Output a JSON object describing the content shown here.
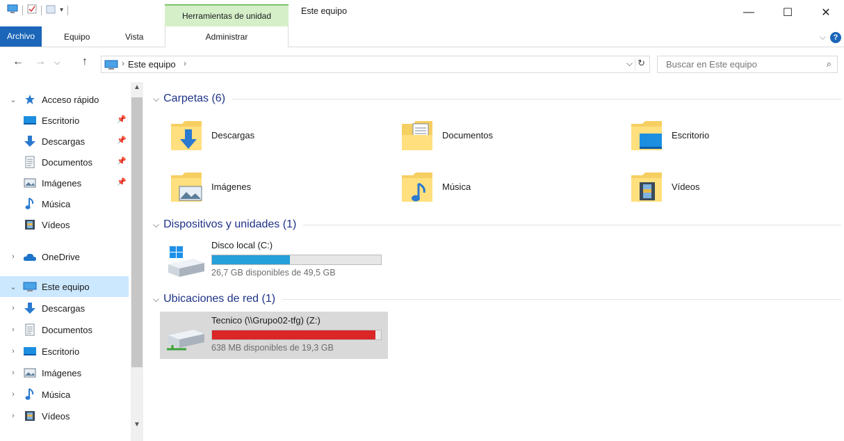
{
  "window": {
    "title": "Este equipo",
    "context_group": "Herramientas de unidad",
    "minimize": "—",
    "maximize": "☐",
    "close": "✕"
  },
  "ribbon": {
    "tabs": [
      "Archivo",
      "Equipo",
      "Vista"
    ],
    "context_tab": "Administrar",
    "collapse_glyph": "⌵",
    "help_glyph": "?"
  },
  "address": {
    "crumb": "Este equipo",
    "separator": "›",
    "back": "←",
    "forward": "→",
    "recent": "⌵",
    "up": "↑",
    "dropdown": "⌵",
    "refresh": "↻"
  },
  "search": {
    "placeholder": "Buscar en Este equipo",
    "icon": "⌕"
  },
  "nav": {
    "items": [
      {
        "label": "Acceso rápido",
        "icon": "star-icon",
        "expanded": "⌄",
        "pinned": ""
      },
      {
        "label": "Escritorio",
        "icon": "desktop-icon",
        "expanded": "",
        "pinned": "📌"
      },
      {
        "label": "Descargas",
        "icon": "download-icon",
        "expanded": "",
        "pinned": "📌"
      },
      {
        "label": "Documentos",
        "icon": "document-icon",
        "expanded": "",
        "pinned": "📌"
      },
      {
        "label": "Imágenes",
        "icon": "pictures-icon",
        "expanded": "",
        "pinned": "📌"
      },
      {
        "label": "Música",
        "icon": "music-icon",
        "expanded": "",
        "pinned": ""
      },
      {
        "label": "Vídeos",
        "icon": "video-icon",
        "expanded": "",
        "pinned": ""
      },
      {
        "label": "OneDrive",
        "icon": "cloud-icon",
        "expanded": "›",
        "pinned": ""
      },
      {
        "label": "Este equipo",
        "icon": "computer-icon",
        "expanded": "⌄",
        "pinned": ""
      },
      {
        "label": "Descargas",
        "icon": "download-icon",
        "expanded": "›",
        "pinned": ""
      },
      {
        "label": "Documentos",
        "icon": "document-icon",
        "expanded": "›",
        "pinned": ""
      },
      {
        "label": "Escritorio",
        "icon": "desktop-icon",
        "expanded": "›",
        "pinned": ""
      },
      {
        "label": "Imágenes",
        "icon": "pictures-icon",
        "expanded": "›",
        "pinned": ""
      },
      {
        "label": "Música",
        "icon": "music-icon",
        "expanded": "›",
        "pinned": ""
      },
      {
        "label": "Vídeos",
        "icon": "video-icon",
        "expanded": "›",
        "pinned": ""
      }
    ]
  },
  "groups": {
    "folders_title": "Carpetas (6)",
    "devices_title": "Dispositivos y unidades (1)",
    "network_title": "Ubicaciones de red (1)",
    "collapse_glyph": "⌵"
  },
  "folders": [
    {
      "name": "Descargas",
      "icon": "downloads-folder-icon"
    },
    {
      "name": "Documentos",
      "icon": "documents-folder-icon"
    },
    {
      "name": "Escritorio",
      "icon": "desktop-folder-icon"
    },
    {
      "name": "Imágenes",
      "icon": "pictures-folder-icon"
    },
    {
      "name": "Música",
      "icon": "music-folder-icon"
    },
    {
      "name": "Vídeos",
      "icon": "videos-folder-icon"
    }
  ],
  "drives": [
    {
      "name": "Disco local (C:)",
      "info": "26,7 GB disponibles de 49,5 GB",
      "used_fraction": 0.46,
      "bar_color": "#26a0da",
      "icon": "local-disk-icon"
    }
  ],
  "network": [
    {
      "name": "Tecnico (\\\\Grupo02-tfg) (Z:)",
      "info": "638 MB disponibles de 19,3 GB",
      "used_fraction": 0.968,
      "bar_color": "#da2626",
      "icon": "network-drive-icon"
    }
  ],
  "colors": {
    "accent": "#1b66b8",
    "selected": "#cce8ff",
    "context_tab": "#d5f0c9"
  }
}
